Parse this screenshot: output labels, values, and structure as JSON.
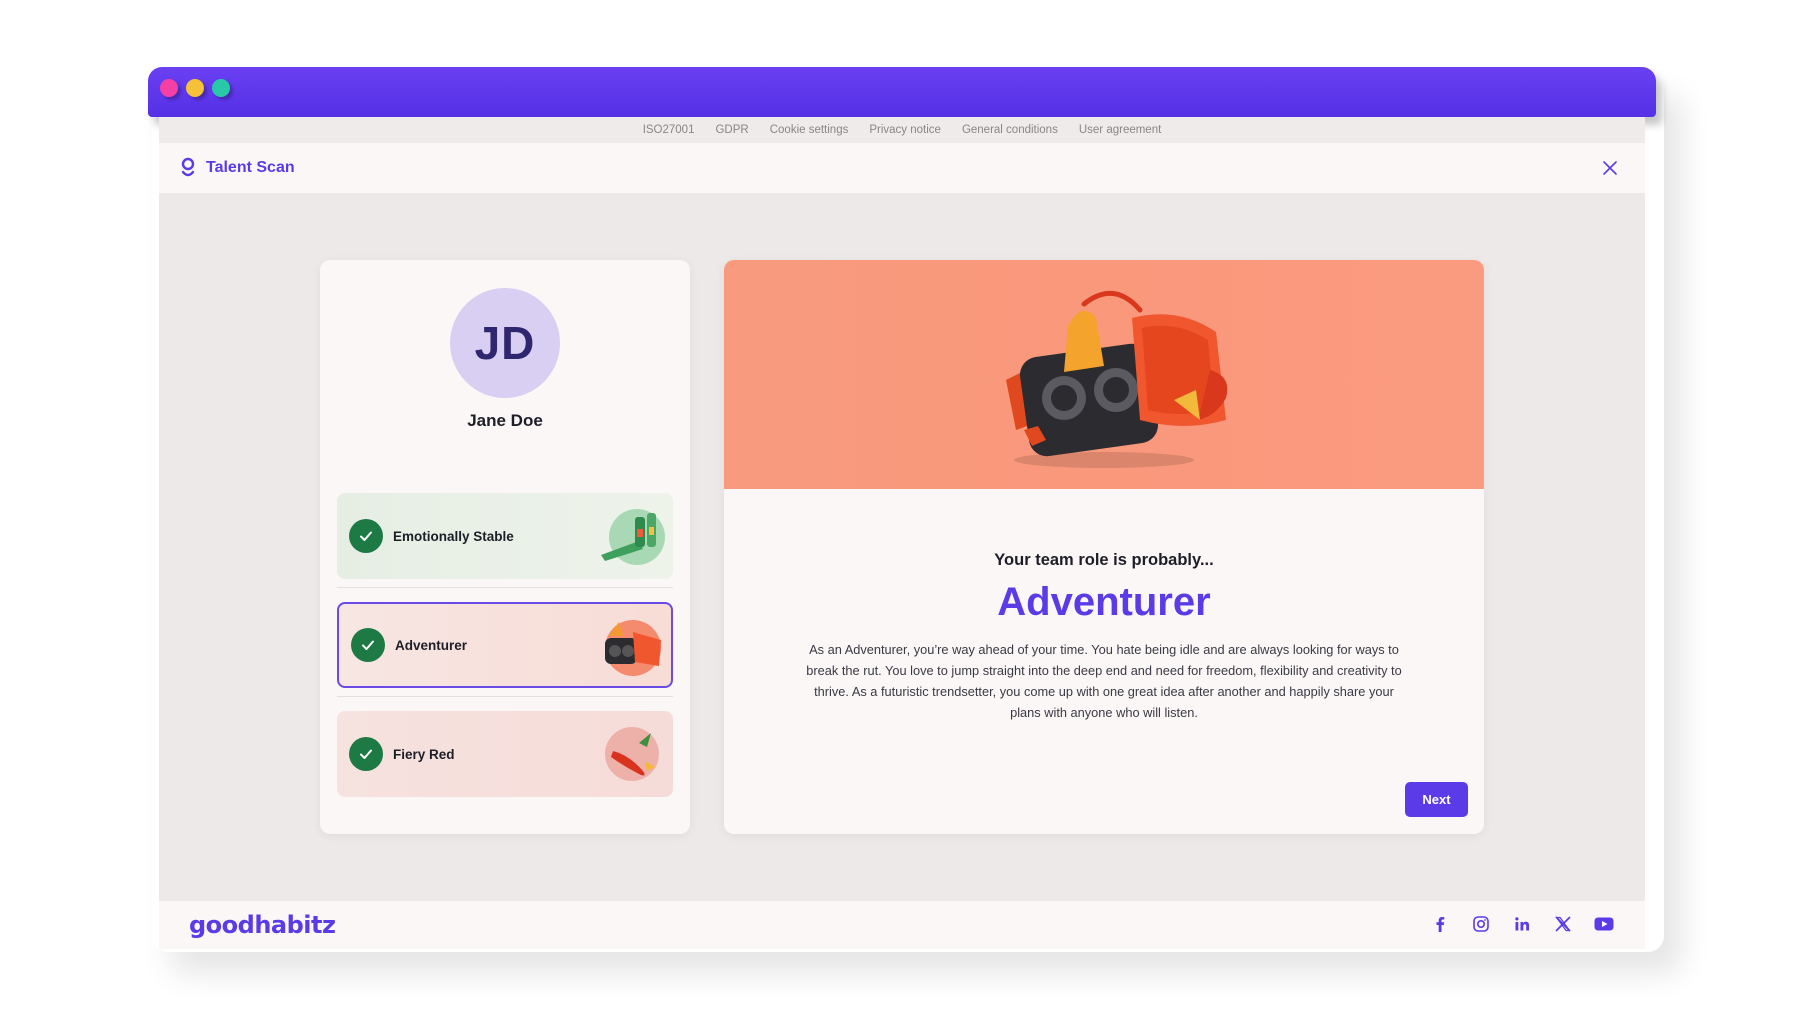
{
  "window": {
    "controls": [
      "close-dot",
      "minimize-dot",
      "maximize-dot"
    ],
    "control_colors": [
      "#f43fa5",
      "#f5c237",
      "#27c9a8"
    ],
    "titlebar_color": "#5b3be8"
  },
  "top_links": [
    "ISO27001",
    "GDPR",
    "Cookie settings",
    "Privacy notice",
    "General conditions",
    "User agreement"
  ],
  "header": {
    "title": "Talent Scan",
    "logo_icon": "goodhabitz-g-icon",
    "close_icon": "close-icon"
  },
  "profile": {
    "initials": "JD",
    "name": "Jane Doe",
    "traits": [
      {
        "label": "Emotionally Stable",
        "status": "completed",
        "icon": "check-icon"
      },
      {
        "label": "Adventurer",
        "status": "selected",
        "icon": "check-icon"
      },
      {
        "label": "Fiery Red",
        "status": "completed",
        "icon": "check-icon"
      }
    ]
  },
  "result": {
    "lead": "Your team role is probably...",
    "title": "Adventurer",
    "description": "As an Adventurer, you’re way ahead of your time. You hate being idle and are always looking for ways to break the rut. You love to jump straight into the deep end and need for freedom, flexibility and creativity to thrive. As a futuristic trendsetter, you come up with one great idea after another and happily share your plans with anyone who will listen.",
    "next_label": "Next"
  },
  "footer": {
    "brand": "goodhabitz",
    "socials": [
      "facebook-icon",
      "instagram-icon",
      "linkedin-icon",
      "x-icon",
      "youtube-icon"
    ]
  },
  "colors": {
    "accent": "#5b3be8",
    "success": "#1d7a44",
    "hero": "#f89a7e",
    "avatar": "#d8cff2"
  }
}
